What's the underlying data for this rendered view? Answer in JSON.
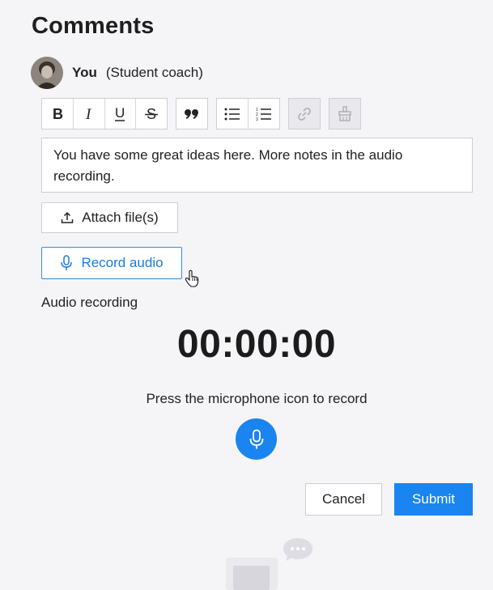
{
  "page": {
    "title": "Comments"
  },
  "author": {
    "name": "You",
    "role": "(Student coach)"
  },
  "toolbar": {
    "format_icons": [
      "bold-icon",
      "italic-icon",
      "underline-icon",
      "strikethrough-icon"
    ],
    "quote_icon": "quote-icon",
    "list_icons": [
      "bulleted-list-icon",
      "numbered-list-icon"
    ],
    "link_icon": "link-icon",
    "clear_format_icon": "clear-formatting-icon"
  },
  "editor": {
    "text": "You have some great ideas here. More notes in the audio recording."
  },
  "actions": {
    "attach_label": "Attach file(s)",
    "record_label": "Record audio"
  },
  "audio": {
    "section_label": "Audio recording",
    "timer": "00:00:00",
    "instruction": "Press the microphone icon to record"
  },
  "footer": {
    "cancel_label": "Cancel",
    "submit_label": "Submit"
  },
  "colors": {
    "accent": "#1a85f0",
    "record_border": "#2f8fe0",
    "background": "#f5f5f8"
  }
}
